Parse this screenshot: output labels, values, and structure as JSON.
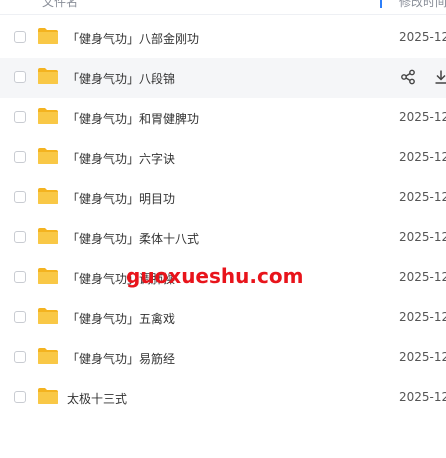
{
  "header": {
    "name_label": "文件名",
    "time_label": "修改时间"
  },
  "files": [
    {
      "name": "「健身气功」八部金刚功",
      "modified": "2025-12"
    },
    {
      "name": "「健身气功」八段锦",
      "modified": "",
      "hovered": true
    },
    {
      "name": "「健身气功」和胃健脾功",
      "modified": "2025-12"
    },
    {
      "name": "「健身气功」六字诀",
      "modified": "2025-12"
    },
    {
      "name": "「健身气功」明目功",
      "modified": "2025-12"
    },
    {
      "name": "「健身气功」柔体十八式",
      "modified": "2025-12"
    },
    {
      "name": "「健身气功」调肺操",
      "modified": "2025-12"
    },
    {
      "name": "「健身气功」五禽戏",
      "modified": "2025-12"
    },
    {
      "name": "「健身气功」易筋经",
      "modified": "2025-12"
    },
    {
      "name": "太极十三式",
      "modified": "2025-12"
    }
  ],
  "hover_actions": {
    "share_icon": "share-icon",
    "download_icon": "download-icon"
  },
  "watermark": "guoxueshu.com",
  "colors": {
    "folder": "#f9c846",
    "folder_back": "#f4b320",
    "accent": "#2d7ff9",
    "watermark": "#e8141b"
  }
}
